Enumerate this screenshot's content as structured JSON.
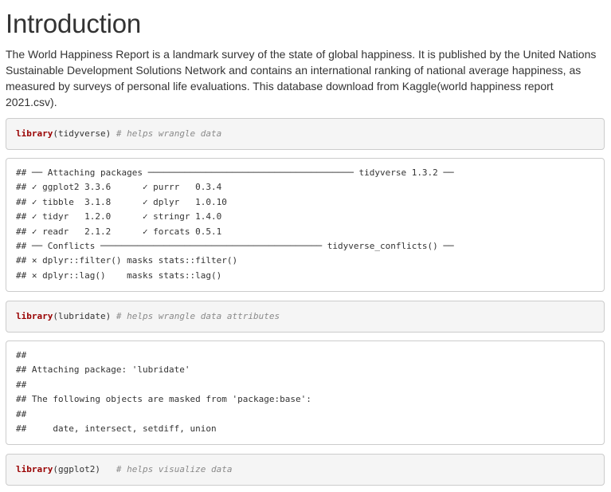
{
  "heading": "Introduction",
  "intro": "The World Happiness Report is a landmark survey of the state of global happiness. It is published by the United Nations Sustainable Development Solutions Network and contains an international ranking of national average happiness, as measured by surveys of personal life evaluations. This database download from Kaggle(world happiness report 2021.csv).",
  "chunks": [
    {
      "fn": "library",
      "args": "(tidyverse) ",
      "comment": "# helps wrangle data"
    },
    {
      "fn": "library",
      "args": "(lubridate) ",
      "comment": "# helps wrangle data attributes"
    },
    {
      "fn": "library",
      "args": "(ggplot2)   ",
      "comment": "# helps visualize data"
    }
  ],
  "outputs": [
    [
      "## ── Attaching packages ─────────────────────────────────────── tidyverse 1.3.2 ──",
      "## ✓ ggplot2 3.3.6      ✓ purrr   0.3.4",
      "## ✓ tibble  3.1.8      ✓ dplyr   1.0.10",
      "## ✓ tidyr   1.2.0      ✓ stringr 1.4.0",
      "## ✓ readr   2.1.2      ✓ forcats 0.5.1",
      "## ── Conflicts ────────────────────────────────────────── tidyverse_conflicts() ──",
      "## ✕ dplyr::filter() masks stats::filter()",
      "## ✕ dplyr::lag()    masks stats::lag()"
    ],
    [
      "##",
      "## Attaching package: 'lubridate'",
      "##",
      "## The following objects are masked from 'package:base':",
      "##",
      "##     date, intersect, setdiff, union"
    ]
  ]
}
